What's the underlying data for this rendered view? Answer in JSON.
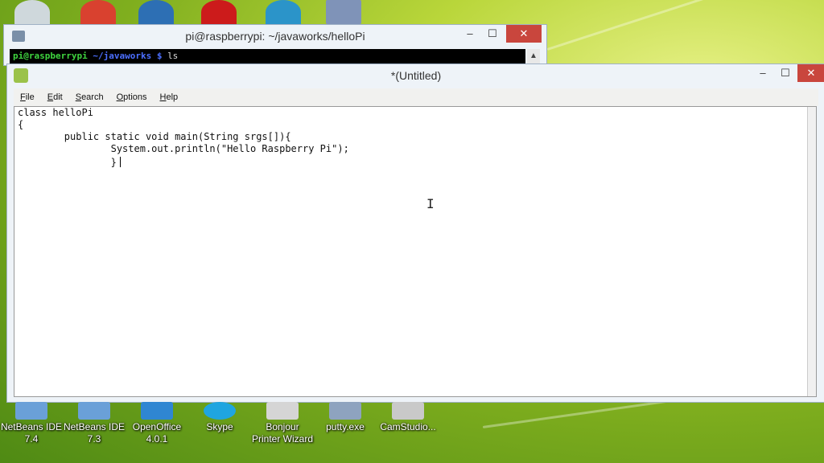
{
  "desktop": {
    "bottom_icons": [
      {
        "label": "NetBeans IDE 7.4",
        "icon": "netbeans-icon"
      },
      {
        "label": "NetBeans IDE 7.3",
        "icon": "netbeans-icon"
      },
      {
        "label": "OpenOffice 4.0.1",
        "icon": "openoffice-icon"
      },
      {
        "label": "Skype",
        "icon": "skype-icon"
      },
      {
        "label": "Bonjour Printer Wizard",
        "icon": "printer-icon"
      },
      {
        "label": "putty.exe",
        "icon": "putty-icon"
      },
      {
        "label": "CamStudio...",
        "icon": "camstudio-icon"
      }
    ]
  },
  "putty_window": {
    "title": "pi@raspberrypi: ~/javaworks/helloPi",
    "prompt_user": "pi@raspberrypi",
    "prompt_path": "~/javaworks $",
    "command": "ls",
    "buttons": {
      "minimize": "–",
      "maximize": "☐",
      "close": "✕"
    }
  },
  "editor_window": {
    "title": "*(Untitled)",
    "menu": [
      "File",
      "Edit",
      "Search",
      "Options",
      "Help"
    ],
    "buttons": {
      "minimize": "–",
      "maximize": "☐",
      "close": "✕"
    },
    "code_lines": [
      "class helloPi",
      "{",
      "        public static void main(String srgs[]){",
      "",
      "                System.out.println(\"Hello Raspberry Pi\");",
      "                }"
    ]
  },
  "colors": {
    "close_red": "#c9463d",
    "terminal_bg": "#000000",
    "prompt_green": "#3fd43f",
    "prompt_blue": "#4c6fff"
  }
}
